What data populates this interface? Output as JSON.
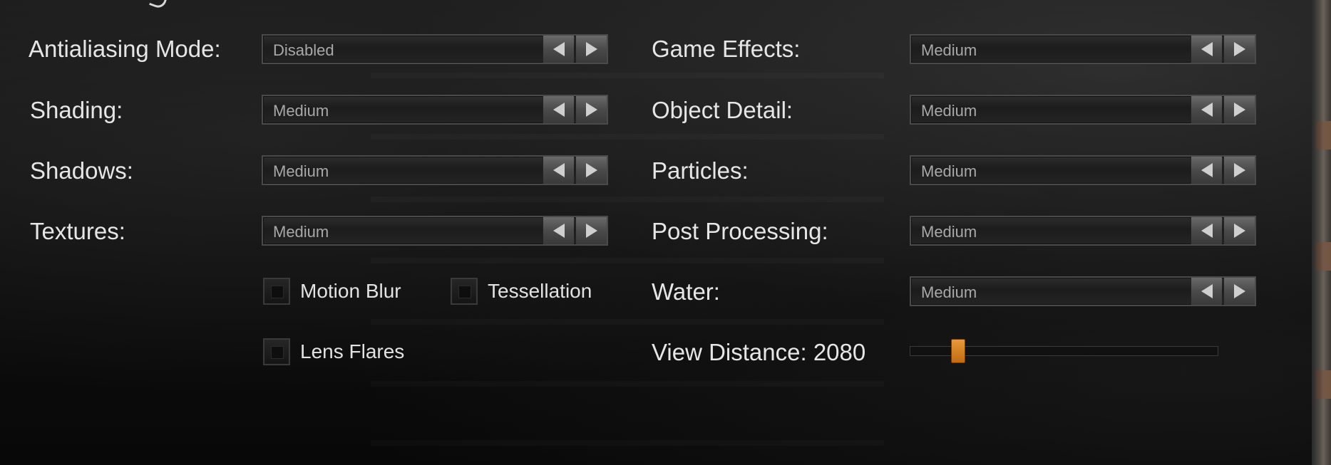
{
  "settings_left": [
    {
      "label": "Antialiasing Mode:",
      "value": "Disabled"
    },
    {
      "label": "Shading:",
      "value": "Medium"
    },
    {
      "label": "Shadows:",
      "value": "Medium"
    },
    {
      "label": "Textures:",
      "value": "Medium"
    }
  ],
  "settings_right": [
    {
      "label": "Game Effects:",
      "value": "Medium"
    },
    {
      "label": "Object Detail:",
      "value": "Medium"
    },
    {
      "label": "Particles:",
      "value": "Medium"
    },
    {
      "label": "Post Processing:",
      "value": "Medium"
    },
    {
      "label": "Water:",
      "value": "Medium"
    }
  ],
  "checkboxes": {
    "motion_blur": {
      "label": "Motion Blur",
      "checked": false
    },
    "tessellation": {
      "label": "Tessellation",
      "checked": false
    },
    "lens_flares": {
      "label": "Lens Flares",
      "checked": false
    }
  },
  "view_distance": {
    "label": "View Distance: 2080",
    "fraction": 0.14
  },
  "icons": {
    "prev": "triangle-left-icon",
    "next": "triangle-right-icon"
  },
  "colors": {
    "accent": "#d7801f",
    "label_text": "#e6e6e6",
    "value_text": "#a9a9a9"
  }
}
